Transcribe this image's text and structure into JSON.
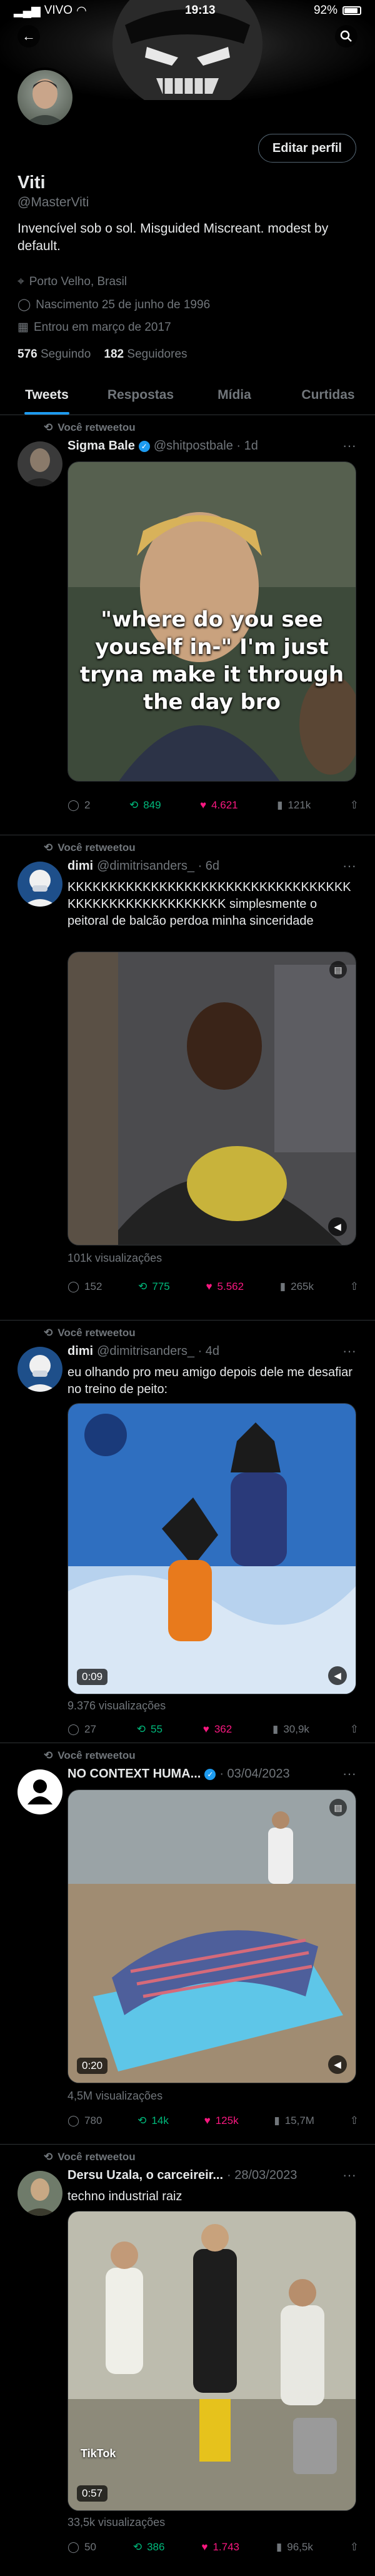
{
  "status_bar": {
    "carrier": "VIVO",
    "time": "19:13",
    "battery": "92%"
  },
  "nav": {
    "back_icon": "arrow-left-icon",
    "search_icon": "search-icon"
  },
  "profile": {
    "name": "Viti",
    "handle": "@MasterViti",
    "edit_label": "Editar perfil",
    "bio": "Invencível sob o sol. Misguided Miscreant. modest by default.",
    "location": "Porto Velho, Brasil",
    "birthday": "Nascimento 25 de junho de 1996",
    "joined": "Entrou em março de 2017",
    "following_count": "576",
    "following_label": "Seguindo",
    "followers_count": "182",
    "followers_label": "Seguidores"
  },
  "tabs": [
    {
      "label": "Tweets",
      "active": true
    },
    {
      "label": "Respostas",
      "active": false
    },
    {
      "label": "Mídia",
      "active": false
    },
    {
      "label": "Curtidas",
      "active": false
    }
  ],
  "tweets": [
    {
      "retweet_label": "Você retweetou",
      "name": "Sigma Bale",
      "verified": true,
      "handle": "@shitpostbale · 1d",
      "text": "",
      "caption": "\"where do you see youself in-\" I'm just tryna make it through the day bro",
      "views": "",
      "replies": "2",
      "retweets": "849",
      "likes": "4.621",
      "stats": "121k"
    },
    {
      "retweet_label": "Você retweetou",
      "name": "dimi",
      "verified": false,
      "handle": "@dimitrisanders_ · 6d",
      "text": "KKKKKKKKKKKKKKKKKKKKKKKKKKKKKKKKKK KKKKKKKKKKKKKKKKKKK simplesmente o peitoral de balcão perdoa minha sinceridade",
      "views": "101k visualizações",
      "replies": "152",
      "retweets": "775",
      "likes": "5.562",
      "stats": "265k"
    },
    {
      "retweet_label": "Você retweetou",
      "name": "dimi",
      "verified": false,
      "handle": "@dimitrisanders_ · 4d",
      "text": "eu olhando pro meu amigo depois dele me desafiar no treino de peito:",
      "duration": "0:09",
      "views": "9.376 visualizações",
      "replies": "27",
      "retweets": "55",
      "likes": "362",
      "stats": "30,9k"
    },
    {
      "retweet_label": "Você retweetou",
      "name": "NO CONTEXT HUMA...",
      "verified": true,
      "handle": "· 03/04/2023",
      "text": "",
      "duration": "0:20",
      "views": "4,5M visualizações",
      "replies": "780",
      "retweets": "14k",
      "likes": "125k",
      "stats": "15,7M"
    },
    {
      "retweet_label": "Você retweetou",
      "name": "Dersu Uzala, o carceireir...",
      "verified": false,
      "handle": "· 28/03/2023",
      "text": "techno industrial raiz",
      "duration": "0:57",
      "media_watermark": "TikTok",
      "views": "33,5k visualizações",
      "replies": "50",
      "retweets": "386",
      "likes": "1.743",
      "stats": "96,5k"
    }
  ],
  "colors": {
    "accent": "#1d9bf0",
    "retweet": "#00ba7c",
    "like": "#f91880",
    "muted": "#71767b"
  }
}
